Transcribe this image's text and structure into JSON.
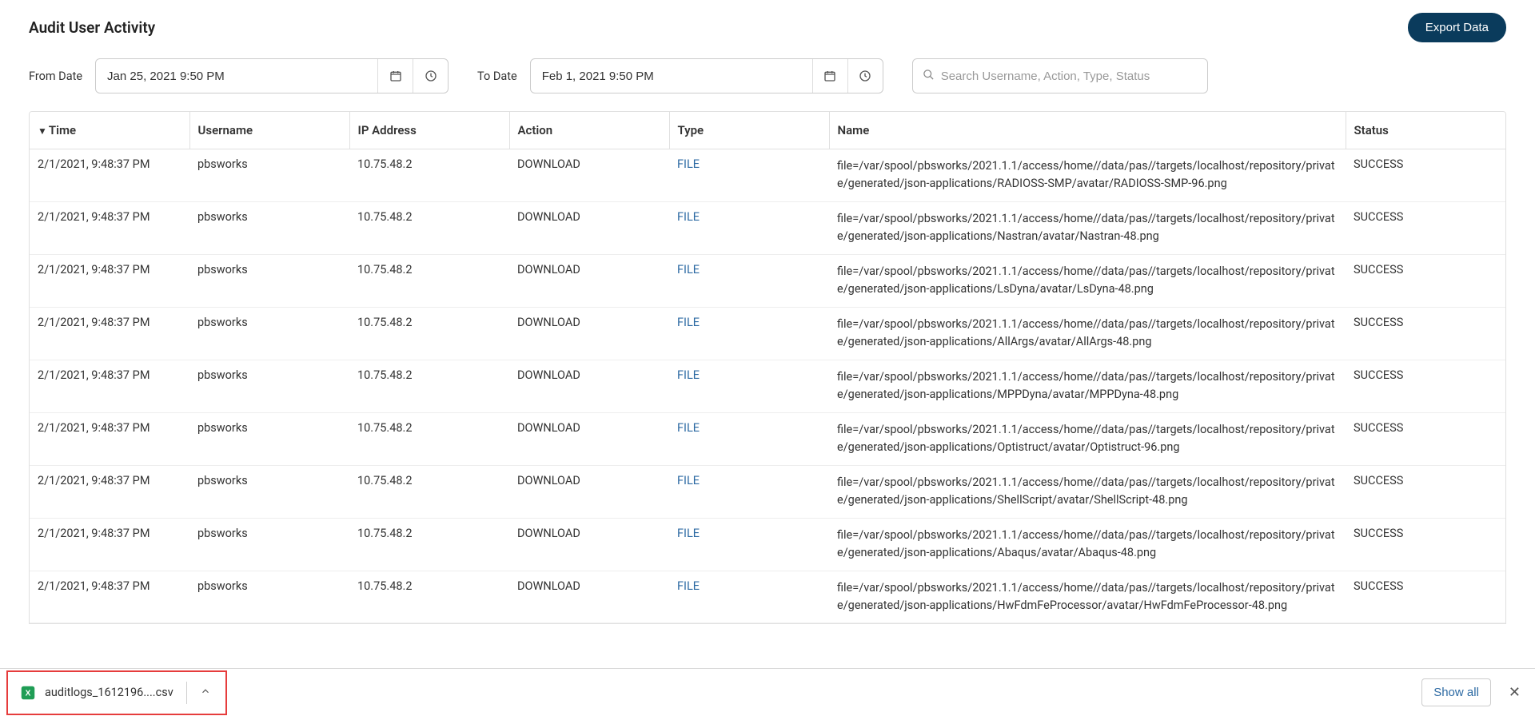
{
  "header": {
    "title": "Audit User Activity",
    "export_label": "Export Data"
  },
  "filters": {
    "from_label": "From Date",
    "from_value": "Jan 25, 2021 9:50 PM",
    "to_label": "To Date",
    "to_value": "Feb 1, 2021 9:50 PM",
    "search_placeholder": "Search Username, Action, Type, Status"
  },
  "table": {
    "columns": {
      "time": "Time",
      "username": "Username",
      "ip": "IP Address",
      "action": "Action",
      "type": "Type",
      "name": "Name",
      "status": "Status"
    },
    "rows": [
      {
        "time": "2/1/2021, 9:48:37 PM",
        "username": "pbsworks",
        "ip": "10.75.48.2",
        "action": "DOWNLOAD",
        "type": "FILE",
        "name": "file=/var/spool/pbsworks/2021.1.1/access/home//data/pas//targets/localhost/repository/private/generated/json-applications/RADIOSS-SMP/avatar/RADIOSS-SMP-96.png",
        "status": "SUCCESS"
      },
      {
        "time": "2/1/2021, 9:48:37 PM",
        "username": "pbsworks",
        "ip": "10.75.48.2",
        "action": "DOWNLOAD",
        "type": "FILE",
        "name": "file=/var/spool/pbsworks/2021.1.1/access/home//data/pas//targets/localhost/repository/private/generated/json-applications/Nastran/avatar/Nastran-48.png",
        "status": "SUCCESS"
      },
      {
        "time": "2/1/2021, 9:48:37 PM",
        "username": "pbsworks",
        "ip": "10.75.48.2",
        "action": "DOWNLOAD",
        "type": "FILE",
        "name": "file=/var/spool/pbsworks/2021.1.1/access/home//data/pas//targets/localhost/repository/private/generated/json-applications/LsDyna/avatar/LsDyna-48.png",
        "status": "SUCCESS"
      },
      {
        "time": "2/1/2021, 9:48:37 PM",
        "username": "pbsworks",
        "ip": "10.75.48.2",
        "action": "DOWNLOAD",
        "type": "FILE",
        "name": "file=/var/spool/pbsworks/2021.1.1/access/home//data/pas//targets/localhost/repository/private/generated/json-applications/AllArgs/avatar/AllArgs-48.png",
        "status": "SUCCESS"
      },
      {
        "time": "2/1/2021, 9:48:37 PM",
        "username": "pbsworks",
        "ip": "10.75.48.2",
        "action": "DOWNLOAD",
        "type": "FILE",
        "name": "file=/var/spool/pbsworks/2021.1.1/access/home//data/pas//targets/localhost/repository/private/generated/json-applications/MPPDyna/avatar/MPPDyna-48.png",
        "status": "SUCCESS"
      },
      {
        "time": "2/1/2021, 9:48:37 PM",
        "username": "pbsworks",
        "ip": "10.75.48.2",
        "action": "DOWNLOAD",
        "type": "FILE",
        "name": "file=/var/spool/pbsworks/2021.1.1/access/home//data/pas//targets/localhost/repository/private/generated/json-applications/Optistruct/avatar/Optistruct-96.png",
        "status": "SUCCESS"
      },
      {
        "time": "2/1/2021, 9:48:37 PM",
        "username": "pbsworks",
        "ip": "10.75.48.2",
        "action": "DOWNLOAD",
        "type": "FILE",
        "name": "file=/var/spool/pbsworks/2021.1.1/access/home//data/pas//targets/localhost/repository/private/generated/json-applications/ShellScript/avatar/ShellScript-48.png",
        "status": "SUCCESS"
      },
      {
        "time": "2/1/2021, 9:48:37 PM",
        "username": "pbsworks",
        "ip": "10.75.48.2",
        "action": "DOWNLOAD",
        "type": "FILE",
        "name": "file=/var/spool/pbsworks/2021.1.1/access/home//data/pas//targets/localhost/repository/private/generated/json-applications/Abaqus/avatar/Abaqus-48.png",
        "status": "SUCCESS"
      },
      {
        "time": "2/1/2021, 9:48:37 PM",
        "username": "pbsworks",
        "ip": "10.75.48.2",
        "action": "DOWNLOAD",
        "type": "FILE",
        "name": "file=/var/spool/pbsworks/2021.1.1/access/home//data/pas//targets/localhost/repository/private/generated/json-applications/HwFdmFeProcessor/avatar/HwFdmFeProcessor-48.png",
        "status": "SUCCESS"
      }
    ]
  },
  "download_bar": {
    "filename": "auditlogs_1612196....csv",
    "show_all": "Show all"
  }
}
